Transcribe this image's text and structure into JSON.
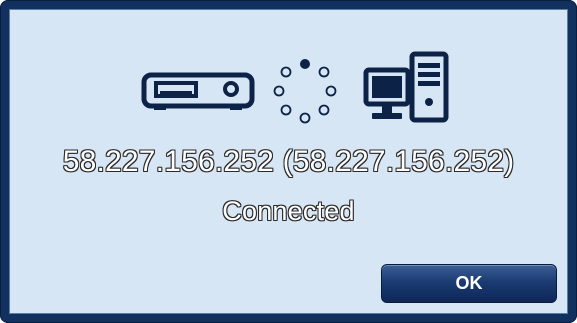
{
  "dialog": {
    "icons": {
      "device": "recorder-device-icon",
      "spinner": "loading-spinner-icon",
      "computer": "computer-icon"
    },
    "address": "58.227.156.252 (58.227.156.252)",
    "status": "Connected",
    "ok_label": "OK"
  },
  "colors": {
    "frame": "#12315f",
    "panel": "#d6e6f4",
    "icon": "#0d2247",
    "button": "#1b3b73"
  }
}
